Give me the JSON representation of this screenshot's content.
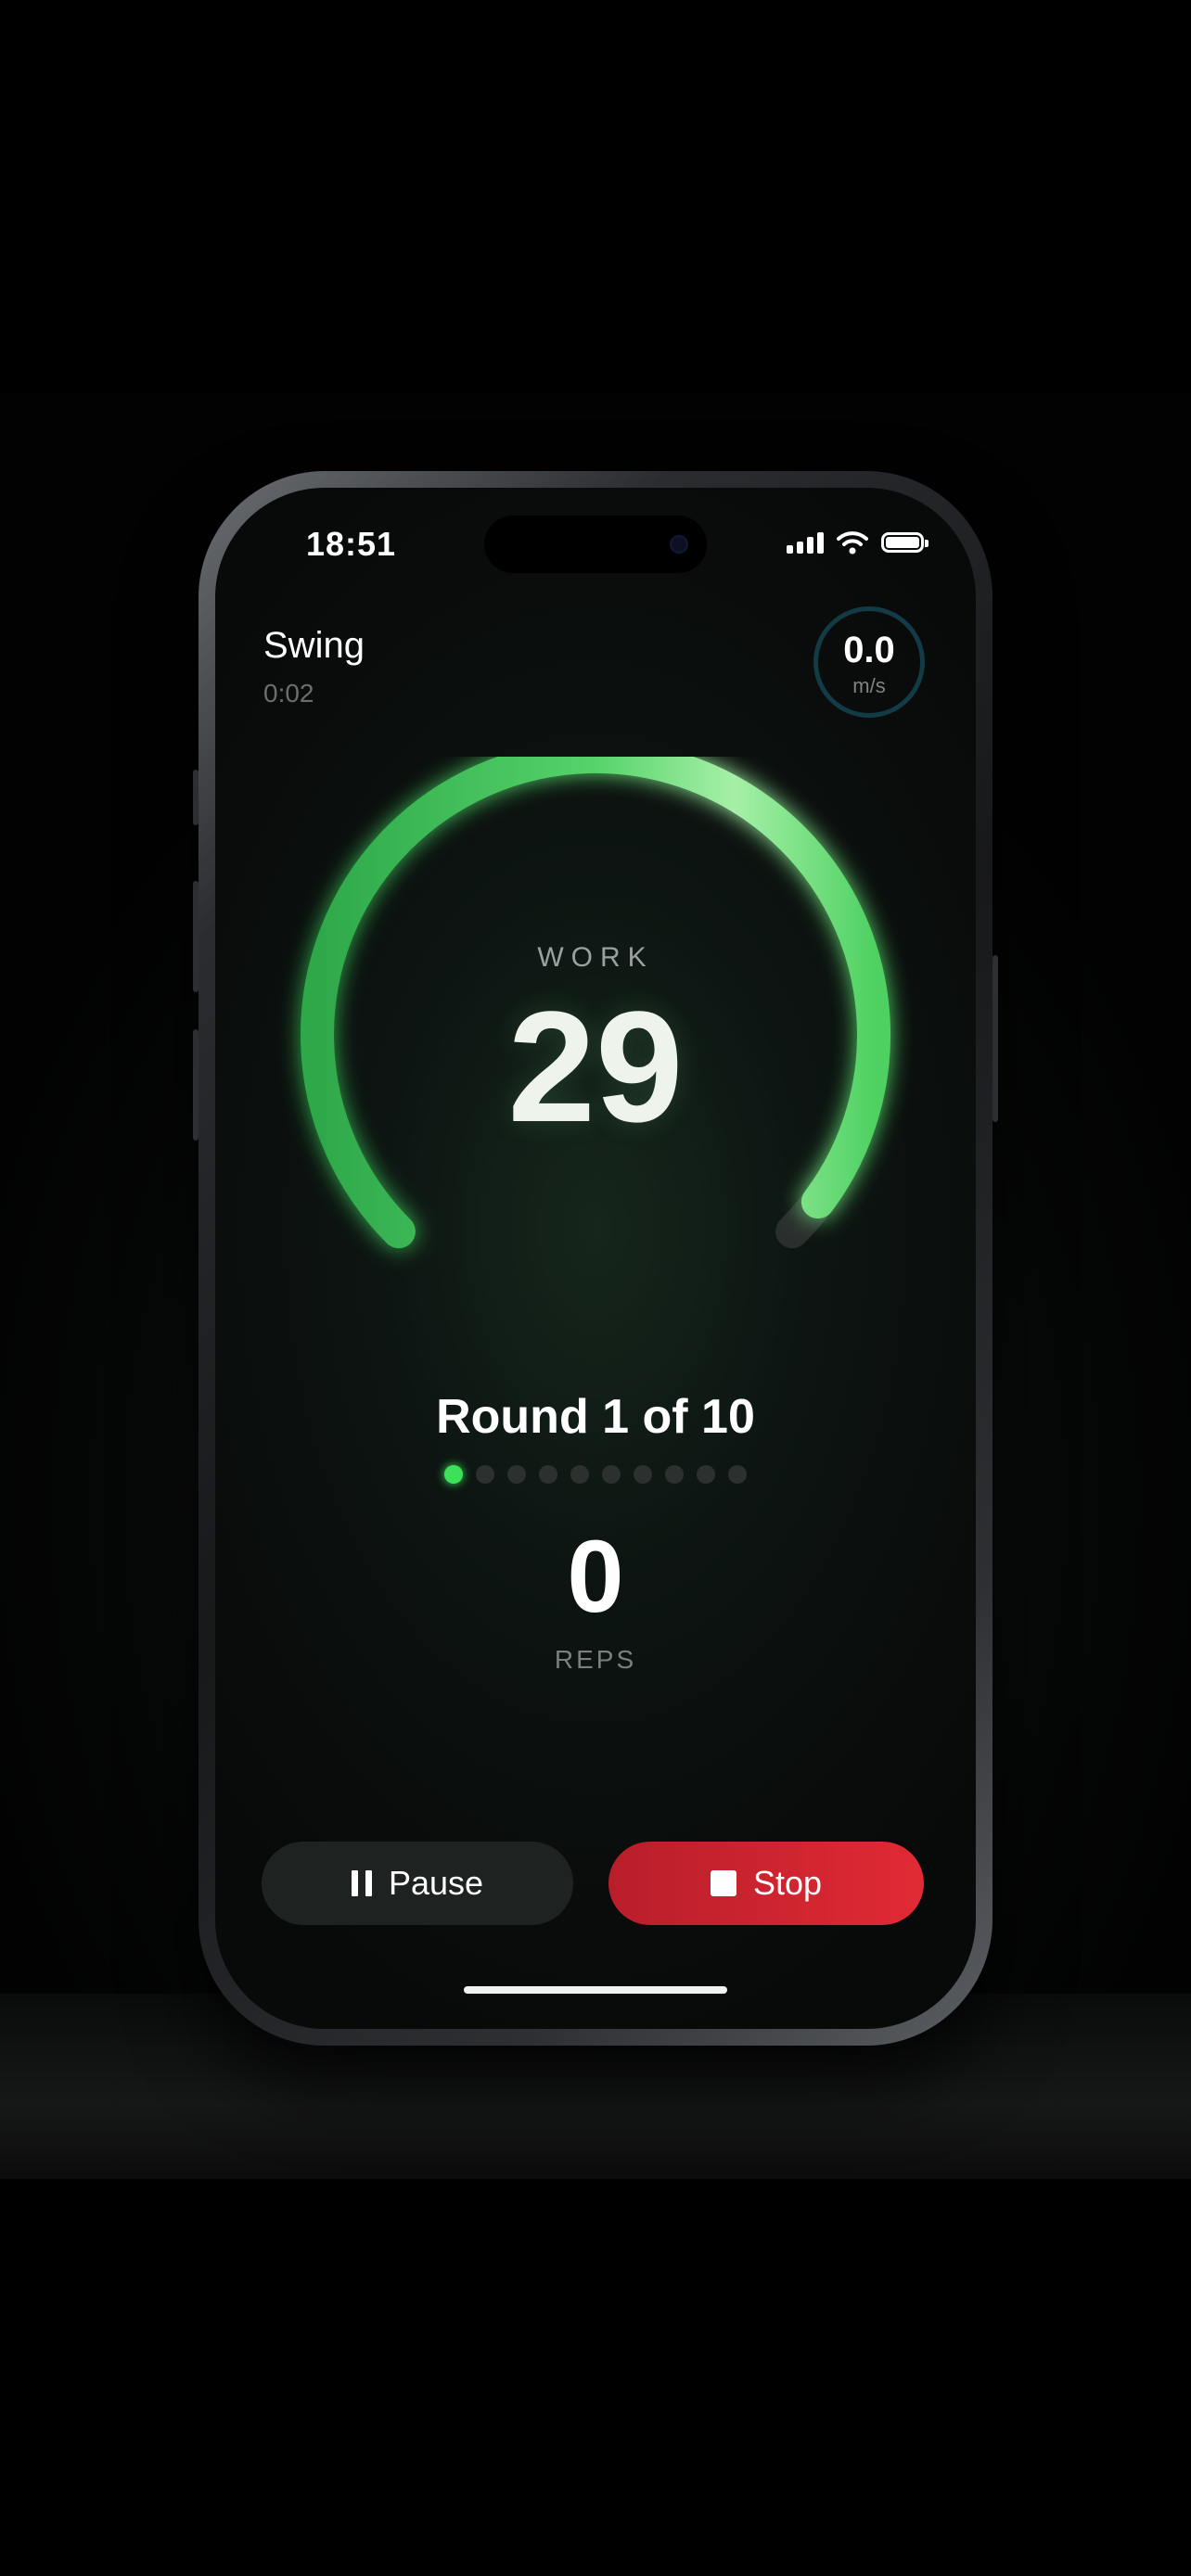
{
  "status_bar": {
    "time": "18:51"
  },
  "header": {
    "exercise": "Swing",
    "elapsed": "0:02"
  },
  "speed_gauge": {
    "value": "0.0",
    "unit": "m/s"
  },
  "timer": {
    "phase": "WORK",
    "seconds_remaining": "29",
    "progress": 0.97
  },
  "round": {
    "label": "Round 1 of 10",
    "current": 1,
    "total": 10
  },
  "reps": {
    "count": "0",
    "label": "REPS"
  },
  "controls": {
    "pause_label": "Pause",
    "stop_label": "Stop"
  },
  "colors": {
    "accent_green": "#3ee05a",
    "stop_red": "#e12a35",
    "speed_ring": "#123b45"
  },
  "icons": [
    "pause-icon",
    "stop-icon",
    "cellular-signal-icon",
    "wifi-icon",
    "battery-icon"
  ]
}
